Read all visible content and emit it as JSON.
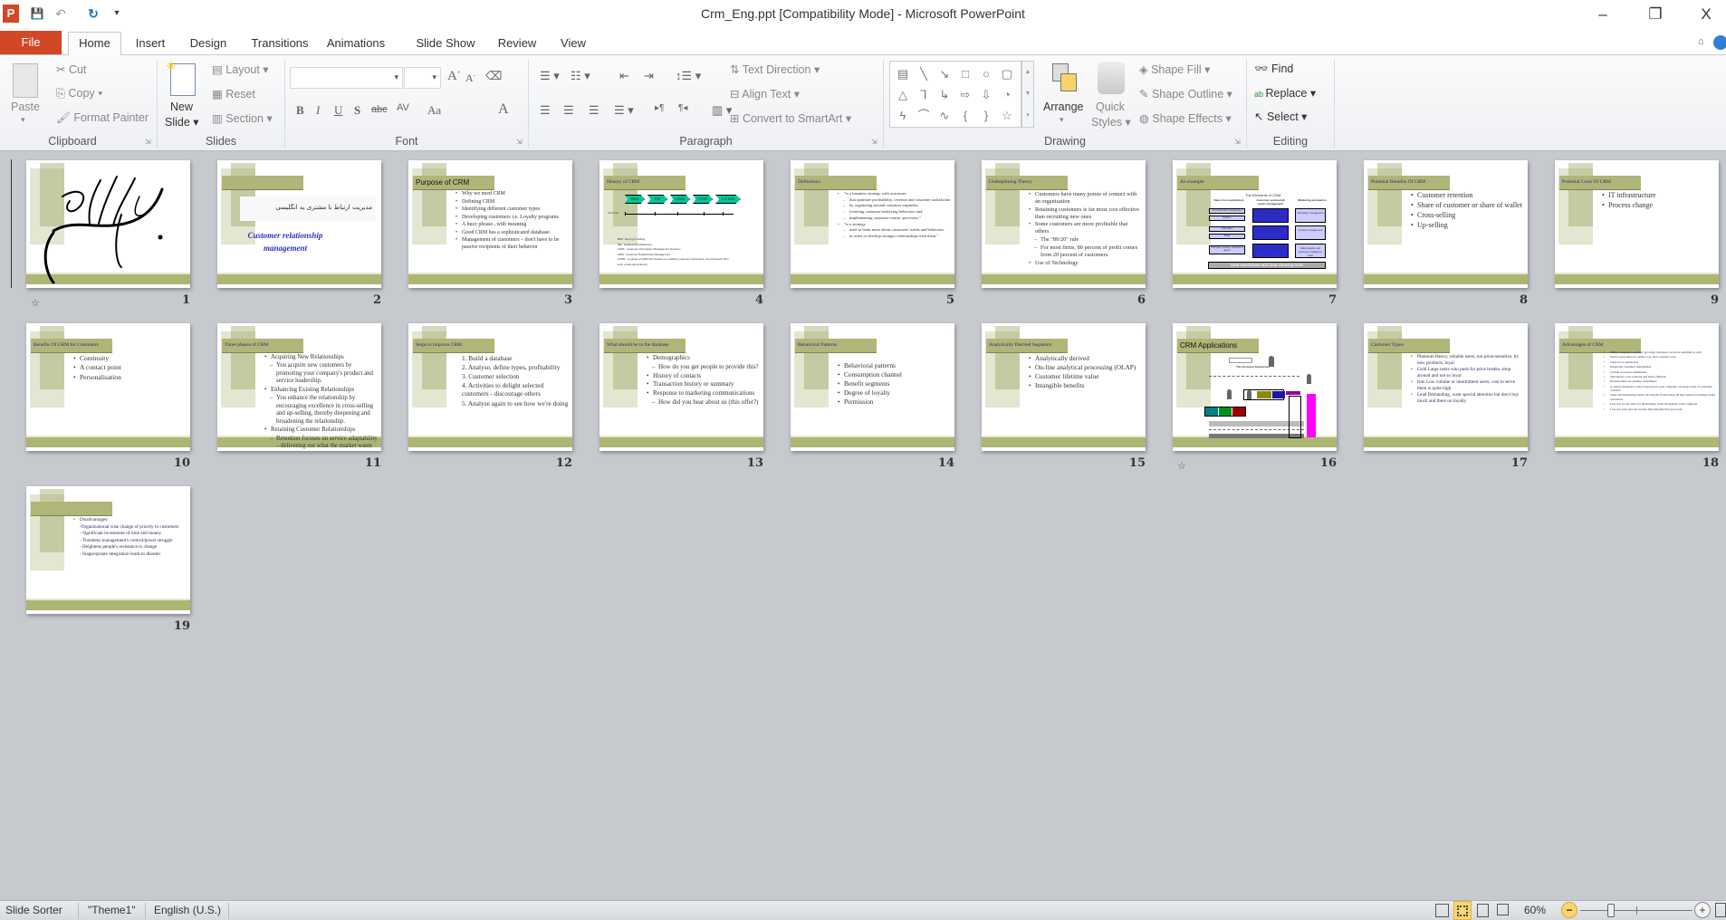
{
  "window": {
    "title": "Crm_Eng.ppt [Compatibility Mode]  -  Microsoft PowerPoint",
    "minimize": "–",
    "restore": "❐",
    "close": "X"
  },
  "quick_access": [
    {
      "icon": "powerpoint-logo-icon",
      "glyph": "P"
    },
    {
      "icon": "save-icon",
      "glyph": "💾"
    },
    {
      "icon": "undo-icon",
      "glyph": "↶"
    },
    {
      "icon": "redo-icon",
      "glyph": "↻"
    },
    {
      "icon": "customize-icon",
      "glyph": "▾"
    }
  ],
  "tabs": {
    "file": "File",
    "items": [
      "Home",
      "Insert",
      "Design",
      "Transitions",
      "Animations",
      "Slide Show",
      "Review",
      "View"
    ],
    "active": "Home"
  },
  "ribbon": {
    "clipboard": {
      "label": "Clipboard",
      "paste": "Paste",
      "cut": "Cut",
      "copy": "Copy",
      "format_painter": "Format Painter"
    },
    "slides": {
      "label": "Slides",
      "new_slide_1": "New",
      "new_slide_2": "Slide",
      "layout": "Layout",
      "reset": "Reset",
      "section": "Section"
    },
    "font": {
      "label": "Font",
      "font_name": "",
      "font_size": "",
      "bold": "B",
      "italic": "I",
      "underline": "U",
      "shadow": "S",
      "strike": "abc",
      "spacing": "AV",
      "case": "Aa",
      "color": "A",
      "grow": "A",
      "shrink": "A"
    },
    "paragraph": {
      "label": "Paragraph",
      "text_direction": "Text Direction",
      "align_text": "Align Text",
      "smartart": "Convert to SmartArt"
    },
    "drawing": {
      "label": "Drawing",
      "arrange": "Arrange",
      "quick_1": "Quick",
      "quick_2": "Styles",
      "shape_fill": "Shape Fill",
      "shape_outline": "Shape Outline",
      "shape_effects": "Shape Effects",
      "shapes": [
        "▤",
        "╲",
        "↘",
        "□",
        "○",
        "▢",
        "△",
        "⅂",
        "↳",
        "⇨",
        "⇩",
        "◔",
        "ϟ",
        "⌒",
        "∿",
        "{",
        "}",
        "☆"
      ]
    },
    "editing": {
      "label": "Editing",
      "find": "Find",
      "replace": "Replace",
      "select": "Select"
    }
  },
  "theme_colors": {
    "slide_title_bar": "#afb678",
    "slide_band": "#adb573",
    "file_tab": "#d24726",
    "chevron": "#00c896",
    "diagram_blue": "#2b2bd0",
    "diagram_light": "#ccccff",
    "magenta": "#ff00ff"
  },
  "slides": [
    {
      "number": "1",
      "title": "",
      "special": "calligraphy",
      "animated": true,
      "bullets": []
    },
    {
      "number": "2",
      "title": "",
      "special": "cover",
      "persian": "مدیریت ارتباط با مشتری به انگلیسی",
      "subtitle_1": "Customer relationship",
      "subtitle_2": "management",
      "bullets": []
    },
    {
      "number": "3",
      "title": "Purpose of CRM",
      "sans": true,
      "bullets": [
        {
          "t": "Why we need CRM"
        },
        {
          "t": "Defining CRM"
        },
        {
          "t": "Identifying different customer types"
        },
        {
          "t": "Developing customers i.e. Loyalty programs"
        },
        {
          "t": "A buzz phrase...with meaning"
        },
        {
          "t": "Good CRM has a sophisticated database"
        },
        {
          "t": "Management of customers – don't have to be passive recipients of their behavior"
        }
      ]
    },
    {
      "number": "4",
      "title": "History of CRM",
      "special": "history",
      "chevrons": [
        "B&S",
        "RM",
        "CIMS",
        "CRM",
        "e-CRM"
      ],
      "timeline": "Time line",
      "legend": [
        "B&S : Buying & Selling",
        "RM : Relationship Marketing",
        "CIMS : Customer Information Management Systems",
        "CRM : Customer Relationship Management",
        "eCRM : A subset of CRM that focuses on enabling customer interactions via eChannels (The web, email and wireless)"
      ],
      "bullets": []
    },
    {
      "number": "5",
      "title": "Definitions",
      "bullets": [
        {
          "t": "\"is a business strategy with outcomes"
        },
        {
          "t": "that optimize profitability, revenue and customer satisfaction",
          "l": 2
        },
        {
          "t": "by organizing around customer segments,",
          "l": 2
        },
        {
          "t": "fostering customer-satisfying behaviors and",
          "l": 2
        },
        {
          "t": "implementing customer-centric processes.\"",
          "l": 2
        },
        {
          "t": "\"is a strategy"
        },
        {
          "t": "used to learn more about customers' needs and behaviors",
          "l": 2
        },
        {
          "t": "in order to develop stronger relationships with them.\"",
          "l": 2
        }
      ]
    },
    {
      "number": "6",
      "title": "Underpinning Theory",
      "bullets": [
        {
          "t": "Customers have many points of contact with an organisation"
        },
        {
          "t": "Retaining customers is far most cost effective than recruiting new ones"
        },
        {
          "t": "Some customers are more profitable that others"
        },
        {
          "t": "The \"80/20\" rule",
          "l": 2
        },
        {
          "t": "For most firms, 80 percent of profit comes from 20 percent of customers.",
          "l": 2
        },
        {
          "t": "Use of Technology"
        }
      ]
    },
    {
      "number": "7",
      "title": "An example",
      "special": "elements",
      "diagram_title": "The Elements of CRM",
      "columns": [
        "Sales force automation",
        "Customer service/call center management",
        "Marketing automation"
      ],
      "left_boxes": [
        "Account/contact management",
        "Pipeline",
        "Field sales",
        "Retail",
        "Third-party resellers, Distributors, agents"
      ],
      "mid_boxes": [
        "Call Centers, Managing aspects of customer contact",
        "Web-based self service",
        "Field services and dispatch"
      ],
      "right_boxes": [
        "Campaign management",
        "Content management",
        "Data analysis and business intelligence tools"
      ],
      "base": "Data warehouse  and data  cleaning  tools",
      "bullets": []
    },
    {
      "number": "8",
      "title": "Potential Benefits Of CRM",
      "bullets": [
        {
          "t": "Customer retention"
        },
        {
          "t": "Share of customer or share of wallet"
        },
        {
          "t": "Cross-selling"
        },
        {
          "t": "Up-selling"
        }
      ]
    },
    {
      "number": "9",
      "title": "Potential Costs Of CRM",
      "bullets": [
        {
          "t": "IT infrastructure"
        },
        {
          "t": "Process change"
        }
      ]
    },
    {
      "number": "10",
      "title": "Benefits Of CRM for Customers",
      "bullets": [
        {
          "t": "Continuity"
        },
        {
          "t": "A contact point"
        },
        {
          "t": "Personalisation"
        }
      ]
    },
    {
      "number": "11",
      "title": "Three phases of CRM",
      "bullets": [
        {
          "t": "Acquiring New Relationships"
        },
        {
          "t": "You acquire new customers by promoting your company's product and service leadership.",
          "l": 2
        },
        {
          "t": "Enhancing Existing Relationships"
        },
        {
          "t": "You enhance the relationship by encouraging excellence in cross-selling and up-selling, thereby deepening and broadening the relationship.",
          "l": 2
        },
        {
          "t": "Retaining Customer Relationships"
        },
        {
          "t": "Retention focuses on service adaptability – delivering not what the market wants but what customers want.",
          "l": 2
        }
      ]
    },
    {
      "number": "12",
      "title": "Steps to improve CRM",
      "bullets": [
        {
          "t": "1.  Build a database",
          "n": 1
        },
        {
          "t": "2.  Analyse, define types, profitability",
          "n": 1
        },
        {
          "t": "3.  Customer selection",
          "n": 1
        },
        {
          "t": "4.  Activities to delight selected customers - discourage others",
          "n": 1
        },
        {
          "t": "5.  Analyse again to see how we're doing",
          "n": 1
        }
      ]
    },
    {
      "number": "13",
      "title": "What should be in the database",
      "bullets": [
        {
          "t": "Demographics"
        },
        {
          "t": "How do you get people to provide this?",
          "l": 2
        },
        {
          "t": "History of contacts"
        },
        {
          "t": "Transaction history or summary"
        },
        {
          "t": "Response to marketing communications"
        },
        {
          "t": "How did you hear about us (this offer?)",
          "l": 2
        }
      ]
    },
    {
      "number": "14",
      "title": "Behavioral Patterns",
      "bullets": [
        {
          "t": "Behavioral patterns"
        },
        {
          "t": "Consumption channel"
        },
        {
          "t": "Benefit segments"
        },
        {
          "t": "Degree of loyalty"
        },
        {
          "t": "Permission"
        }
      ]
    },
    {
      "number": "15",
      "title": "Analytically Derived Segments",
      "bullets": [
        {
          "t": "Analytically derived"
        },
        {
          "t": "On-line analytical processing (OLAP)"
        },
        {
          "t": "Customer lifetime value"
        },
        {
          "t": "Intangible benefits"
        }
      ]
    },
    {
      "number": "16",
      "title": "CRM Applications",
      "sans": true,
      "special": "apps",
      "animated": true,
      "exp": "The Customer Experience",
      "bullets": []
    },
    {
      "number": "17",
      "title": "Customer Types",
      "bullets": [
        {
          "t": "Platinum Heavy, reliable users, not price-sensitive, try new products, loyal"
        },
        {
          "t": "Gold Large users who push for price breaks, shop around and not so loyal"
        },
        {
          "t": "Iron Low volume or intermittent users; cost to serve them is quite high"
        },
        {
          "t": "Lead Demanding, want special attention but don't buy much and there no loyalty"
        }
      ]
    },
    {
      "number": "18",
      "title": "Advantages of CRM",
      "bullets": [
        {
          "t": "While company is quickly growing customers are more satisfied as well"
        },
        {
          "t": "Service provided in a better way, and a quicker way"
        },
        {
          "t": "Sales force automated"
        },
        {
          "t": "Integrated customer information"
        },
        {
          "t": "Certain processes eliminated"
        },
        {
          "t": "Operations costs reduced and more efficient"
        },
        {
          "t": "Brand names are quickly established"
        },
        {
          "t": "A central database so that everyone in your company can keep track of customer contacts"
        },
        {
          "t": "Sales and marketing teams can benefit from having all this inside knowledge about customers"
        },
        {
          "t": "Lets you set up rules for distributing work throughout your company"
        },
        {
          "t": "Lets you pick and choose the functionality that you want"
        }
      ]
    },
    {
      "number": "19",
      "title": "",
      "bullets": [
        {
          "t": "Disadvantages:"
        },
        {
          "t": "-Organizational wise change of priority to customers",
          "p": 1
        },
        {
          "t": " - Significant investment of time and money",
          "p": 1
        },
        {
          "t": " - Threatens management's control/power struggle",
          "p": 1
        },
        {
          "t": " - Heightens people's resistance to change",
          "p": 1
        },
        {
          "t": " - Inappropriate integration leads to disaster",
          "p": 1
        }
      ]
    }
  ],
  "statusbar": {
    "view": "Slide Sorter",
    "theme": "\"Theme1\"",
    "language": "English (U.S.)",
    "zoom": "60%",
    "zoom_percent": 60,
    "minus": "−",
    "plus": "+"
  }
}
